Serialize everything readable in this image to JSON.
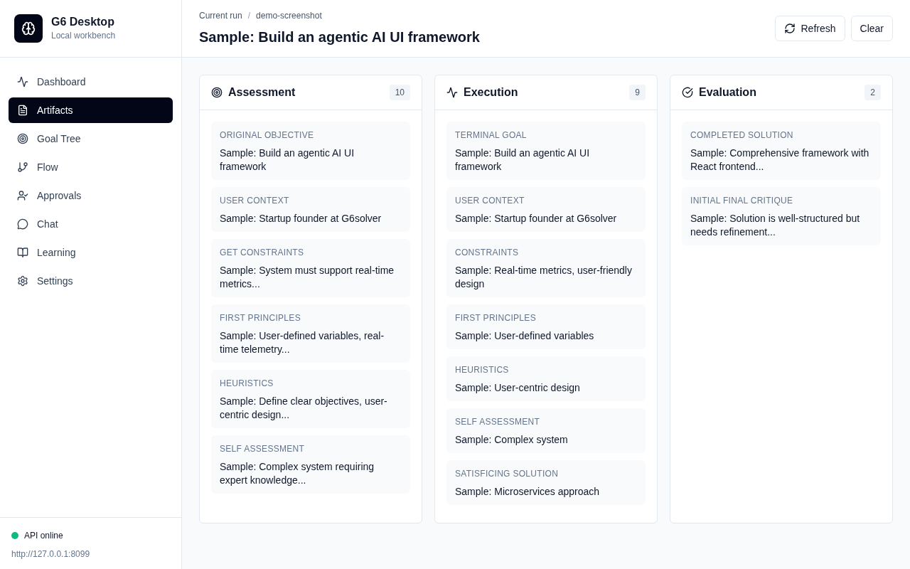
{
  "app": {
    "title": "G6 Desktop",
    "subtitle": "Local workbench"
  },
  "nav": [
    {
      "label": "Dashboard",
      "selected": false
    },
    {
      "label": "Artifacts",
      "selected": true
    },
    {
      "label": "Goal Tree",
      "selected": false
    },
    {
      "label": "Flow",
      "selected": false
    },
    {
      "label": "Approvals",
      "selected": false
    },
    {
      "label": "Chat",
      "selected": false
    },
    {
      "label": "Learning",
      "selected": false
    },
    {
      "label": "Settings",
      "selected": false
    }
  ],
  "status": {
    "label": "API online",
    "color": "#10b981",
    "url": "http://127.0.0.1:8099"
  },
  "breadcrumb": {
    "items": [
      "Current run",
      "demo-screenshot"
    ],
    "separator": "/"
  },
  "title": "Sample: Build an agentic AI UI framework",
  "actions": [
    "Refresh",
    "Clear"
  ],
  "columns": [
    {
      "title": "Assessment",
      "count": "10",
      "cards": [
        {
          "label": "ORIGINAL OBJECTIVE",
          "text": "Sample: Build an agentic AI UI framework"
        },
        {
          "label": "USER CONTEXT",
          "text": "Sample: Startup founder at G6solver"
        },
        {
          "label": "GET CONSTRAINTS",
          "text": "Sample: System must support real-time metrics..."
        },
        {
          "label": "FIRST PRINCIPLES",
          "text": "Sample: User-defined variables, real-time telemetry..."
        },
        {
          "label": "HEURISTICS",
          "text": "Sample: Define clear objectives, user-centric design..."
        },
        {
          "label": "SELF ASSESSMENT",
          "text": "Sample: Complex system requiring expert knowledge..."
        }
      ]
    },
    {
      "title": "Execution",
      "count": "9",
      "cards": [
        {
          "label": "TERMINAL GOAL",
          "text": "Sample: Build an agentic AI UI framework"
        },
        {
          "label": "USER CONTEXT",
          "text": "Sample: Startup founder at G6solver"
        },
        {
          "label": "CONSTRAINTS",
          "text": "Sample: Real-time metrics, user-friendly design"
        },
        {
          "label": "FIRST PRINCIPLES",
          "text": "Sample: User-defined variables"
        },
        {
          "label": "HEURISTICS",
          "text": "Sample: User-centric design"
        },
        {
          "label": "SELF ASSESSMENT",
          "text": "Sample: Complex system"
        },
        {
          "label": "SATISFICING SOLUTION",
          "text": "Sample: Microservices approach"
        }
      ]
    },
    {
      "title": "Evaluation",
      "count": "2",
      "cards": [
        {
          "label": "COMPLETED SOLUTION",
          "text": "Sample: Comprehensive framework with React frontend..."
        },
        {
          "label": "INITIAL FINAL CRITIQUE",
          "text": "Sample: Solution is well-structured but needs refinement..."
        }
      ]
    }
  ]
}
